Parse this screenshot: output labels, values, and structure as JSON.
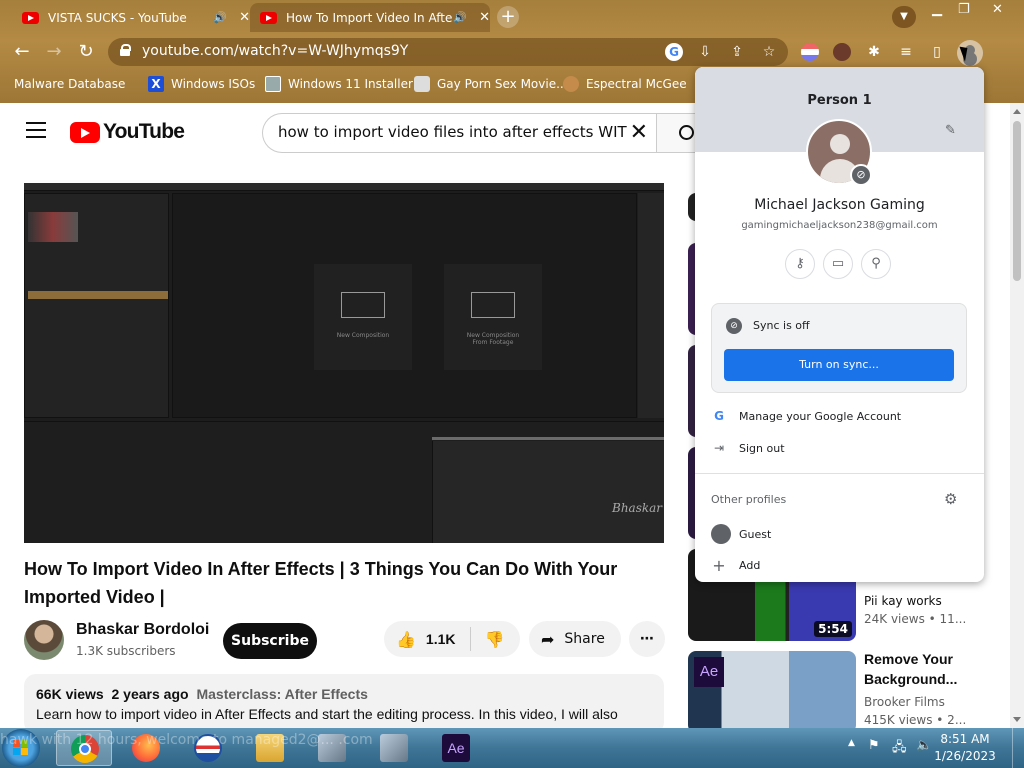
{
  "browser": {
    "tabs": [
      {
        "title": "VISTA SUCKS - YouTube"
      },
      {
        "title": "How To Import Video In Afte"
      }
    ],
    "url": "youtube.com/watch?v=W-WJhymqs9Y",
    "bookmarks": [
      "Malware Database",
      "Windows ISOs",
      "Windows 11 Installer",
      "Gay Porn Sex Movie...",
      "Espectral McGee"
    ]
  },
  "youtube": {
    "logo_text": "YouTube",
    "search_query": "how to import video files into after effects WITH I",
    "player": {
      "ae_tile1": "New Composition",
      "ae_tile2_line1": "New Composition",
      "ae_tile2_line2": "From Footage",
      "signature": "Bhaskar"
    },
    "video_title": "How To Import Video In After Effects | 3 Things You Can Do With Your Imported Video |",
    "channel_name": "Bhaskar Bordoloi",
    "subscribers": "1.3K subscribers",
    "subscribe_label": "Subscribe",
    "likes": "1.1K",
    "share_label": "Share",
    "views": "66K views",
    "age": "2 years ago",
    "tag": "Masterclass: After Effects",
    "description": "Learn how to import video in After Effects and start the editing process. In this video, I will also",
    "recommendations": [
      {
        "title": "",
        "channel": "Pii kay works",
        "meta": "24K views  • 11...",
        "duration": "5:54"
      },
      {
        "title_line1": "Remove Your",
        "title_line2": "Background...",
        "channel": "Brooker Films",
        "meta": "415K views  • 2..."
      }
    ]
  },
  "profile_menu": {
    "title": "Person 1",
    "name": "Michael Jackson Gaming",
    "email": "gamingmichaeljackson238@gmail.com",
    "sync_status": "Sync is off",
    "sync_button": "Turn on sync...",
    "manage_account": "Manage your Google Account",
    "sign_out": "Sign out",
    "other_profiles": "Other profiles",
    "guest": "Guest",
    "add": "Add"
  },
  "taskbar": {
    "time": "8:51 AM",
    "date": "1/26/2023",
    "ghost_text": "hawk with 12 hours, welcome to managed2@... .com"
  }
}
